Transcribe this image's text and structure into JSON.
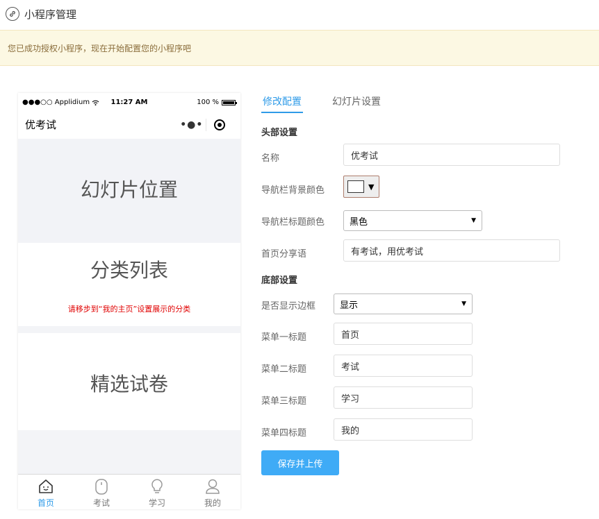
{
  "header": {
    "title": "小程序管理",
    "icon": "link-icon"
  },
  "notice": {
    "text": "您已成功授权小程序，现在开始配置您的小程序吧"
  },
  "phone": {
    "status": {
      "carrier": "●●●○○ Applidium",
      "time": "11:27 AM",
      "battery": "100 %",
      "battery_level": 1.0
    },
    "nav_title": "优考试",
    "nav_more": "•●•",
    "slide": "幻灯片位置",
    "categories": "分类列表",
    "categories_hint": "请移步到“我的主页”设置展示的分类",
    "papers": "精选试卷",
    "tabs": [
      {
        "label": "首页",
        "icon": "home-icon",
        "active": true
      },
      {
        "label": "考试",
        "icon": "exam-icon",
        "active": false
      },
      {
        "label": "学习",
        "icon": "lightbulb-icon",
        "active": false
      },
      {
        "label": "我的",
        "icon": "user-icon",
        "active": false
      }
    ]
  },
  "form": {
    "tabs": [
      {
        "label": "修改配置",
        "active": true
      },
      {
        "label": "幻灯片设置",
        "active": false
      }
    ],
    "header_section": "头部设置",
    "name_label": "名称",
    "name_value": "优考试",
    "nav_bg_label": "导航栏背景颜色",
    "nav_bg_color": "#ffffff",
    "nav_title_color_label": "导航栏标题颜色",
    "nav_title_color_value": "黑色",
    "share_label": "首页分享语",
    "share_value": "有考试，用优考试",
    "footer_section": "底部设置",
    "border_label": "是否显示边框",
    "border_value": "显示",
    "menu1_label": "菜单一标题",
    "menu1_value": "首页",
    "menu2_label": "菜单二标题",
    "menu2_value": "考试",
    "menu3_label": "菜单三标题",
    "menu3_value": "学习",
    "menu4_label": "菜单四标题",
    "menu4_value": "我的",
    "submit_label": "保存并上传"
  },
  "colors": {
    "accent": "#2f9be8",
    "button": "#3fabf6",
    "notice_bg": "#fcf8e3",
    "notice_text": "#8a6d3b",
    "hint": "#e00000"
  }
}
